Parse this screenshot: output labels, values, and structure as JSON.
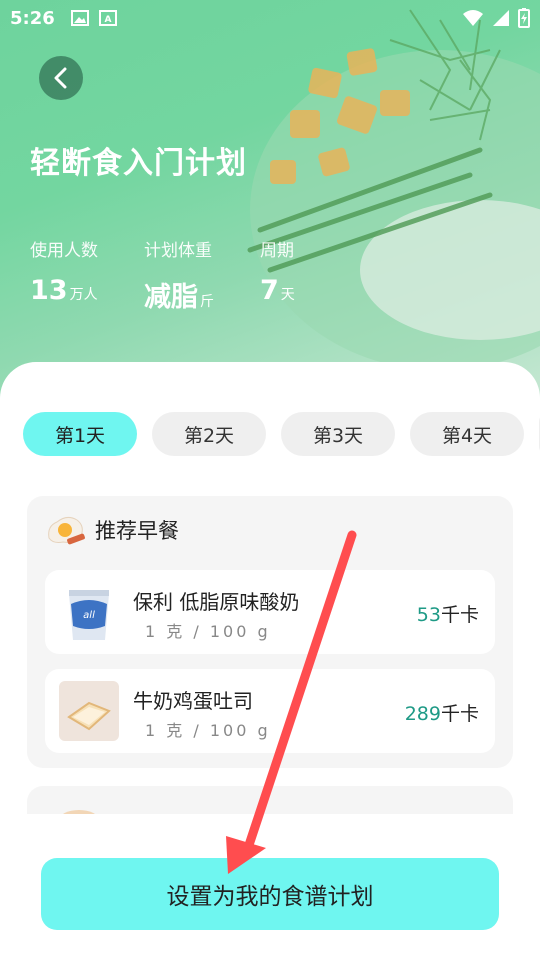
{
  "status_bar": {
    "time": "5:26",
    "icons": [
      "image-icon",
      "keyboard-icon",
      "wifi-icon",
      "signal-icon",
      "battery-charging-icon"
    ]
  },
  "header": {
    "title": "轻断食入门计划",
    "stats": [
      {
        "label": "使用人数",
        "value": "13",
        "unit": "万人"
      },
      {
        "label": "计划体重",
        "value": "减脂",
        "unit": "斤"
      },
      {
        "label": "周期",
        "value": "7",
        "unit": "天"
      }
    ]
  },
  "tabs": [
    {
      "label": "第1天",
      "active": true
    },
    {
      "label": "第2天",
      "active": false
    },
    {
      "label": "第3天",
      "active": false
    },
    {
      "label": "第4天",
      "active": false
    }
  ],
  "meals": [
    {
      "title": "推荐早餐",
      "icon": "breakfast-egg-icon",
      "items": [
        {
          "name": "保利 低脂原味酸奶",
          "portion": "1 克 / 100 g",
          "kcal": "53",
          "kcal_unit": "千卡",
          "thumb": "yogurt-cup"
        },
        {
          "name": "牛奶鸡蛋吐司",
          "portion": "1 克 / 100 g",
          "kcal": "289",
          "kcal_unit": "千卡",
          "thumb": "toast-slice"
        }
      ]
    }
  ],
  "cta": {
    "label": "设置为我的食谱计划"
  },
  "colors": {
    "accent": "#6ff6f0",
    "header_green": "#6ed39d",
    "kcal": "#1e9a86",
    "annotation_arrow": "#ff4d4f"
  }
}
